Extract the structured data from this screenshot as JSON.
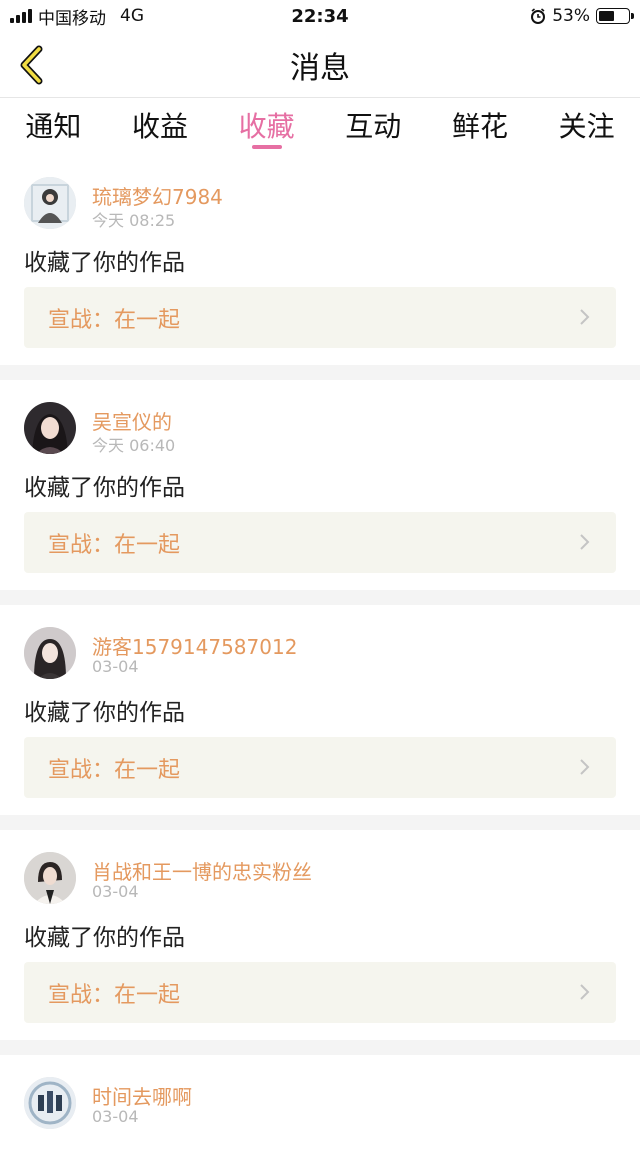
{
  "status_bar": {
    "carrier": "中国移动",
    "network": "4G",
    "time": "22:34",
    "battery": "53%",
    "battery_level": 0.53
  },
  "header": {
    "title": "消息",
    "back_icon": "chevron-left-icon"
  },
  "tabs": [
    {
      "label": "通知",
      "active": false
    },
    {
      "label": "收益",
      "active": false
    },
    {
      "label": "收藏",
      "active": true
    },
    {
      "label": "互动",
      "active": false
    },
    {
      "label": "鲜花",
      "active": false
    },
    {
      "label": "关注",
      "active": false
    }
  ],
  "colors": {
    "accent": "#e66fa3",
    "username": "#e4995f",
    "work_bg": "#f5f5ee",
    "divider": "#f4f4f4"
  },
  "messages": [
    {
      "name": "琉璃梦幻7984",
      "time": "今天 08:25",
      "action": "收藏了你的作品",
      "work": "宣战：在一起"
    },
    {
      "name": "吴宣仪的",
      "time": "今天 06:40",
      "action": "收藏了你的作品",
      "work": "宣战：在一起"
    },
    {
      "name": "游客1579147587012",
      "time": "03-04",
      "action": "收藏了你的作品",
      "work": "宣战：在一起"
    },
    {
      "name": "肖战和王一博的忠实粉丝",
      "time": "03-04",
      "action": "收藏了你的作品",
      "work": "宣战：在一起"
    },
    {
      "name": "时间去哪啊",
      "time": "03-04",
      "action": "",
      "work": ""
    }
  ]
}
